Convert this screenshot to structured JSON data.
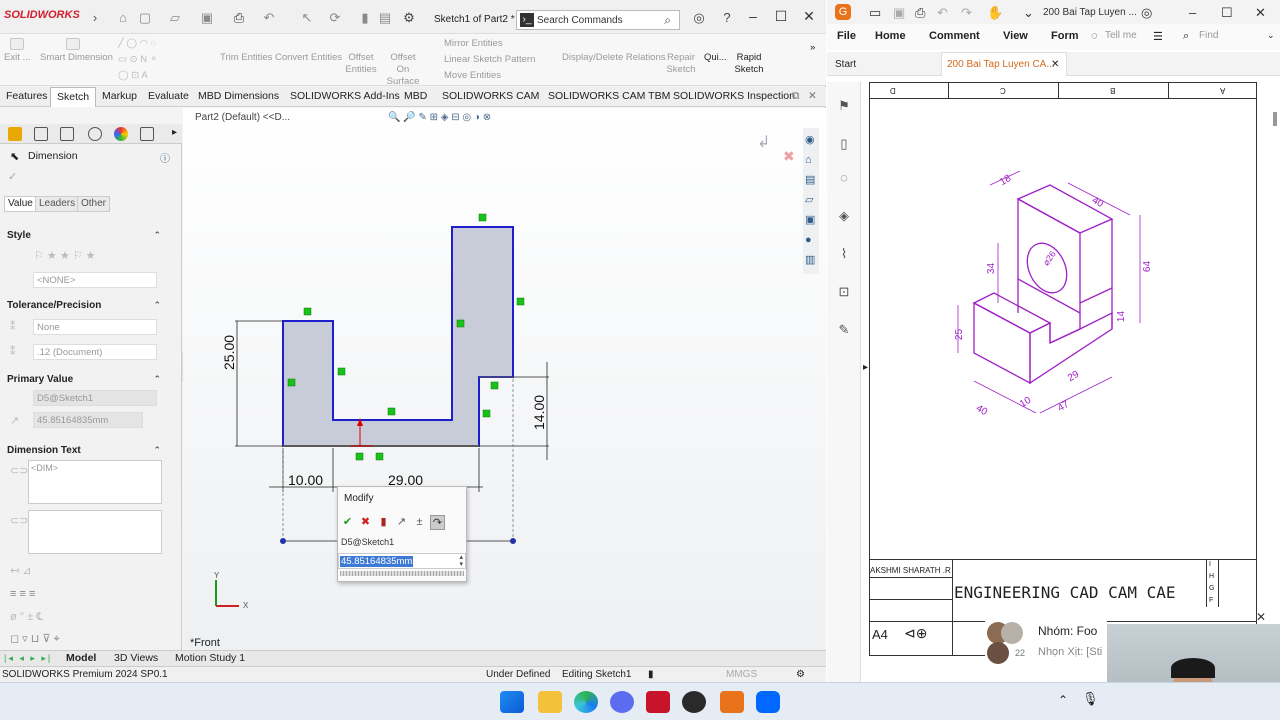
{
  "sw": {
    "logo": "SOLIDWORKS",
    "doc_title": "Sketch1 of Part2 *",
    "search_placeholder": "Search Commands",
    "ribbon": {
      "exit": "Exit ...",
      "smart_dimension": "Smart Dimension",
      "trim": "Trim Entities",
      "convert": "Convert Entities",
      "offset_entities": "Offset Entities",
      "offset_on_surface": "Offset On Surface",
      "mirror": "Mirror Entities",
      "linear_pattern": "Linear Sketch Pattern",
      "move": "Move Entities",
      "display_delete": "Display/Delete Relations",
      "repair": "Repair Sketch",
      "quick": "Qui...",
      "rapid": "Rapid Sketch"
    },
    "tabs": [
      "Features",
      "Sketch",
      "Markup",
      "Evaluate",
      "MBD Dimensions",
      "SOLIDWORKS Add-Ins",
      "MBD",
      "SOLIDWORKS CAM",
      "SOLIDWORKS CAM TBM",
      "SOLIDWORKS Inspection"
    ],
    "fm": {
      "title": "Dimension",
      "tabs": [
        "Value",
        "Leaders",
        "Other"
      ],
      "style_header": "Style",
      "style_value": "<NONE>",
      "tol_header": "Tolerance/Precision",
      "tol_value": "None",
      "precision_value": ".12 (Document)",
      "primary_header": "Primary Value",
      "primary_name": "D5@Sketch1",
      "primary_value": "45.85164835mm",
      "dimtext_header": "Dimension Text",
      "dimtext_value": "<DIM>"
    },
    "breadcrumb": "Part2 (Default) <<D...",
    "dims": {
      "d25": "25.00",
      "d14": "14.00",
      "d10": "10.00",
      "d29": "29.00"
    },
    "modify": {
      "title": "Modify",
      "name": "D5@Sketch1",
      "value": "45.85164835mm"
    },
    "front_label": "*Front",
    "bottom_tabs": [
      "Model",
      "3D Views",
      "Motion Study 1"
    ],
    "status": {
      "edition": "SOLIDWORKS Premium 2024 SP0.1",
      "defined": "Under Defined",
      "editing": "Editing Sketch1",
      "units": "MMGS"
    }
  },
  "pdf": {
    "title": "200 Bai Tap Luyen ...",
    "menu": [
      "File",
      "Home",
      "Comment",
      "View",
      "Form"
    ],
    "tell_me": "Tell me",
    "find": "Find",
    "tabs": [
      "Start",
      "200 Bai Tap Luyen CA..."
    ],
    "border_letters": [
      "D",
      "C",
      "B",
      "A"
    ],
    "row_letters": [
      "I",
      "H",
      "G",
      "F"
    ],
    "drawing_dims": [
      "18",
      "40",
      "26",
      "34",
      "64",
      "14",
      "25",
      "29",
      "10",
      "40",
      "47"
    ],
    "diameter_symbol": "⌀",
    "title_block_name": "AKSHMI SHARATH .R",
    "title_block_company": "ENGINEERING CAD CAM CAE",
    "sheet_size": "A4"
  },
  "chat": {
    "group": "Nhóm: Foo",
    "count": "22",
    "message": "Nhọn Xịt: [Sti"
  }
}
